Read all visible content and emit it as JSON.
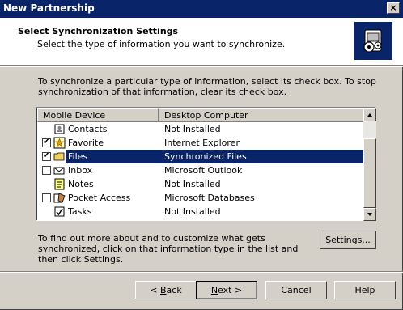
{
  "window": {
    "title": "New Partnership",
    "close_glyph": "×"
  },
  "header": {
    "title": "Select Synchronization Settings",
    "subtitle": "Select the type of information you want to synchronize.",
    "icon": "sync-settings-icon"
  },
  "intro_text": "To synchronize a particular type of information, select its check box. To stop synchronization of that information, clear its check box.",
  "list": {
    "columns": [
      "Mobile Device",
      "Desktop Computer"
    ],
    "rows": [
      {
        "name": "Contacts",
        "desktop": "Not Installed",
        "checkbox": false,
        "checked": false,
        "selected": false,
        "icon": "contacts-icon"
      },
      {
        "name": "Favorite",
        "desktop": "Internet Explorer",
        "checkbox": true,
        "checked": true,
        "selected": false,
        "icon": "favorite-star-icon"
      },
      {
        "name": "Files",
        "desktop": "Synchronized Files",
        "checkbox": true,
        "checked": true,
        "selected": true,
        "icon": "folder-icon"
      },
      {
        "name": "Inbox",
        "desktop": "Microsoft Outlook",
        "checkbox": true,
        "checked": false,
        "selected": false,
        "icon": "inbox-icon"
      },
      {
        "name": "Notes",
        "desktop": "Not Installed",
        "checkbox": false,
        "checked": false,
        "selected": false,
        "icon": "notes-icon"
      },
      {
        "name": "Pocket Access",
        "desktop": "Microsoft Databases",
        "checkbox": true,
        "checked": false,
        "selected": false,
        "icon": "pocket-access-icon"
      },
      {
        "name": "Tasks",
        "desktop": "Not Installed",
        "checkbox": false,
        "checked": false,
        "selected": false,
        "icon": "tasks-icon"
      }
    ]
  },
  "note_text": "To find out more about and to customize what gets synchronized, click on that information type in the list and then click Settings.",
  "buttons": {
    "settings": {
      "pre": "",
      "accel": "S",
      "post": "ettings..."
    },
    "back": {
      "pre": "< ",
      "accel": "B",
      "post": "ack"
    },
    "next": {
      "pre": "",
      "accel": "N",
      "post": "ext >"
    },
    "cancel": "Cancel",
    "help": "Help"
  },
  "colors": {
    "titlebar": "#0a246a",
    "selection": "#0a246a",
    "face": "#d4d0c8"
  }
}
